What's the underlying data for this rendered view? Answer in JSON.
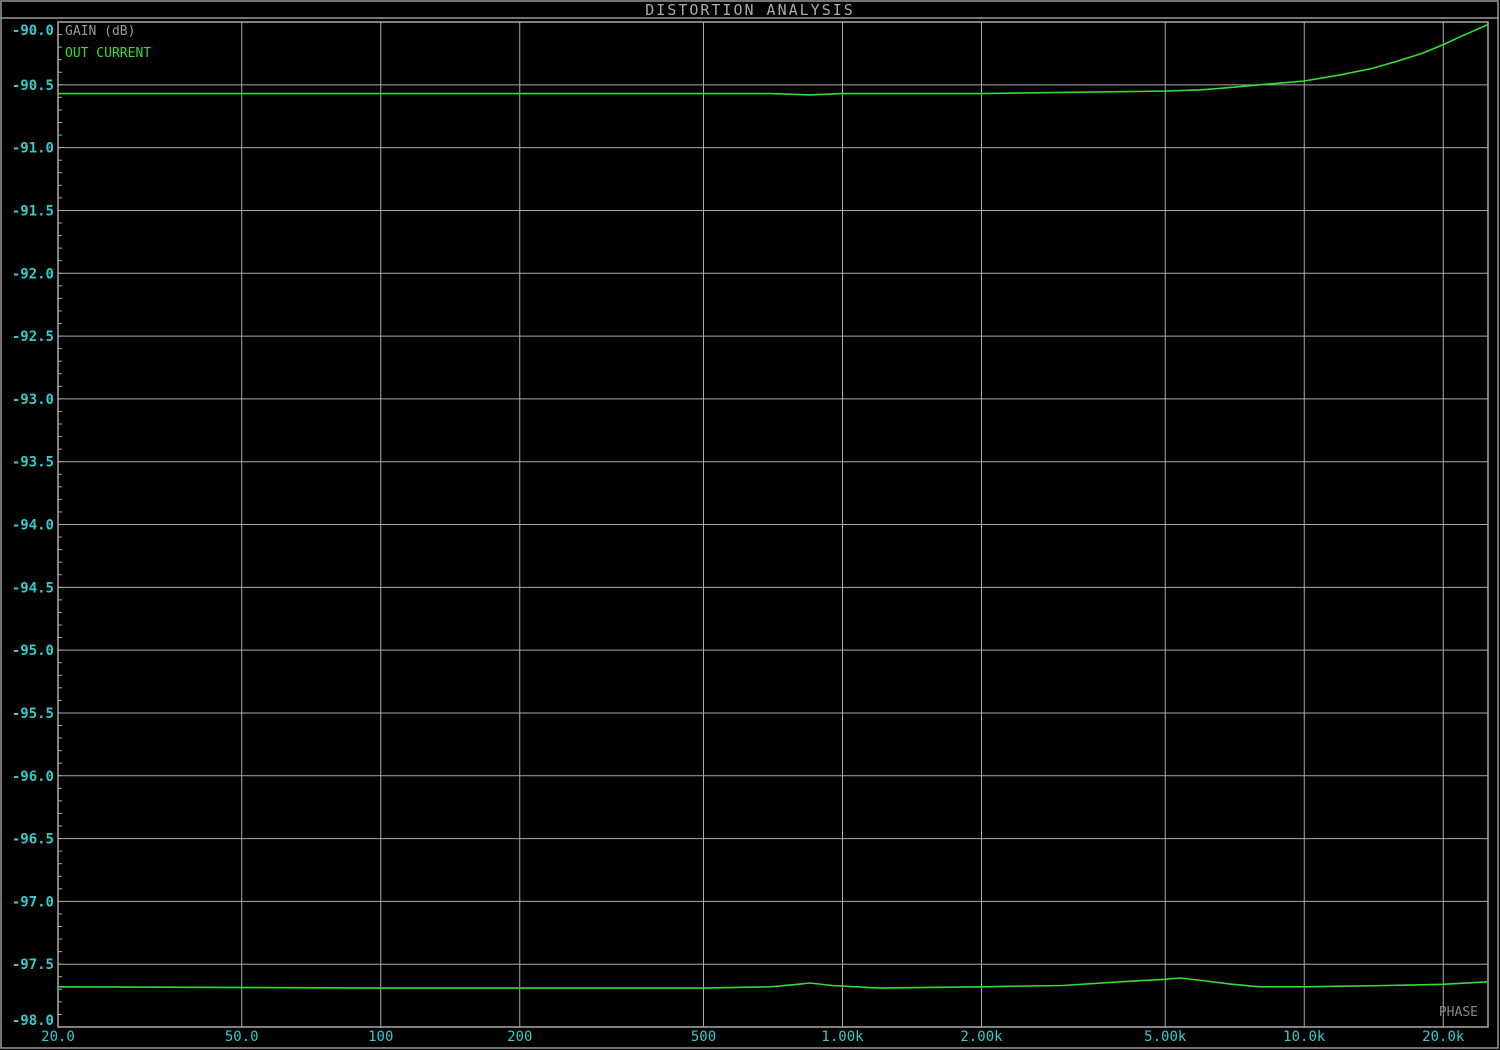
{
  "chart_data": {
    "type": "line",
    "title": "DISTORTION ANALYSIS",
    "ylabel": "GAIN (dB)",
    "xlabel": "",
    "corner_label": "PHASE",
    "xscale": "log",
    "xlim": [
      20,
      25000
    ],
    "ylim": [
      -98.0,
      -90.0
    ],
    "grid": true,
    "x_ticks": [
      20,
      50,
      100,
      200,
      500,
      1000,
      2000,
      5000,
      10000,
      20000
    ],
    "x_tick_labels": [
      "20.0",
      "50.0",
      "100",
      "200",
      "500",
      "1.00k",
      "2.00k",
      "5.00k",
      "10.0k",
      "20.0k"
    ],
    "y_ticks": [
      -90.0,
      -90.5,
      -91.0,
      -91.5,
      -92.0,
      -92.5,
      -93.0,
      -93.5,
      -94.0,
      -94.5,
      -95.0,
      -95.5,
      -96.0,
      -96.5,
      -97.0,
      -97.5,
      -98.0
    ],
    "y_tick_labels": [
      "-90.0",
      "-90.5",
      "-91.0",
      "-91.5",
      "-92.0",
      "-92.5",
      "-93.0",
      "-93.5",
      "-94.0",
      "-94.5",
      "-95.0",
      "-95.5",
      "-96.0",
      "-96.5",
      "-97.0",
      "-97.5",
      "-98.0"
    ],
    "legend": [
      "OUT CURRENT"
    ],
    "legend_placement": "top-left",
    "colors": {
      "trace": "#33dd33",
      "axis_text": "#33cccc",
      "grid": "#aaaaaa",
      "label": "#999999"
    },
    "series": [
      {
        "name": "OUT CURRENT (upper)",
        "x": [
          20,
          100,
          500,
          700,
          850,
          1000,
          2000,
          3000,
          5000,
          6000,
          7000,
          8000,
          10000,
          12000,
          14000,
          16000,
          18000,
          20000,
          22000,
          25000
        ],
        "y": [
          -90.57,
          -90.57,
          -90.57,
          -90.57,
          -90.58,
          -90.57,
          -90.57,
          -90.56,
          -90.55,
          -90.54,
          -90.52,
          -90.5,
          -90.47,
          -90.42,
          -90.37,
          -90.31,
          -90.25,
          -90.18,
          -90.11,
          -90.02
        ]
      },
      {
        "name": "OUT CURRENT (lower)",
        "x": [
          20,
          100,
          500,
          700,
          800,
          850,
          950,
          1200,
          2000,
          3000,
          4000,
          5000,
          5400,
          6000,
          7000,
          8000,
          10000,
          15000,
          20000,
          25000
        ],
        "y": [
          -97.68,
          -97.69,
          -97.69,
          -97.68,
          -97.66,
          -97.65,
          -97.67,
          -97.69,
          -97.68,
          -97.67,
          -97.64,
          -97.62,
          -97.61,
          -97.63,
          -97.66,
          -97.68,
          -97.68,
          -97.67,
          -97.66,
          -97.64
        ]
      }
    ]
  }
}
